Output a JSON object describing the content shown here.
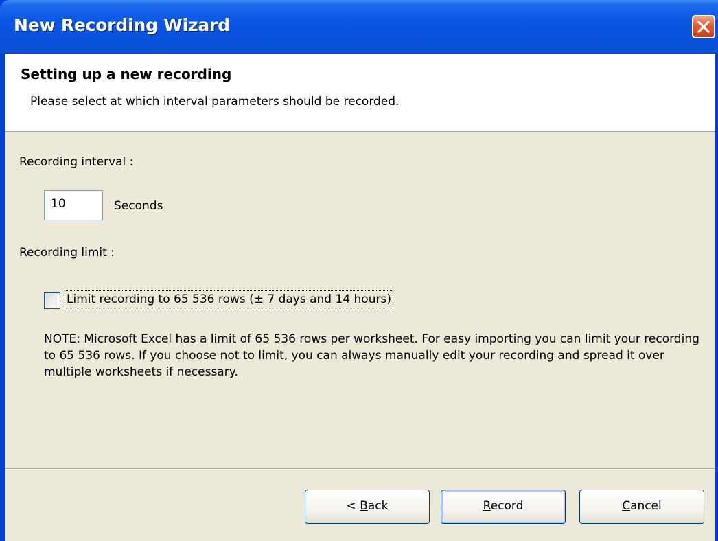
{
  "window": {
    "title": "New Recording Wizard",
    "close_icon": "close-icon"
  },
  "header": {
    "heading": "Setting up a new recording",
    "subheading": "Please select at which interval parameters should be recorded."
  },
  "interval": {
    "label": "Recording interval :",
    "value": "10",
    "unit": "Seconds"
  },
  "limit": {
    "label": "Recording limit :",
    "checkbox_label": "Limit recording to 65 536 rows (± 7 days and 14 hours)",
    "checked": false
  },
  "note": "NOTE: Microsoft Excel has a limit of 65 536 rows per worksheet. For easy importing you can limit your recording to 65 536 rows. If you choose not to limit, you can always manually edit your recording and spread it over multiple worksheets if necessary.",
  "buttons": {
    "back": {
      "prefix": "< ",
      "key": "B",
      "rest": "ack"
    },
    "record": {
      "prefix": "",
      "key": "R",
      "rest": "ecord"
    },
    "cancel": {
      "prefix": "",
      "key": "C",
      "rest": "ancel"
    }
  },
  "colors": {
    "titlebar": "#0a56e4",
    "dialog_bg": "#ece9d8",
    "close_button": "#e35a30"
  }
}
